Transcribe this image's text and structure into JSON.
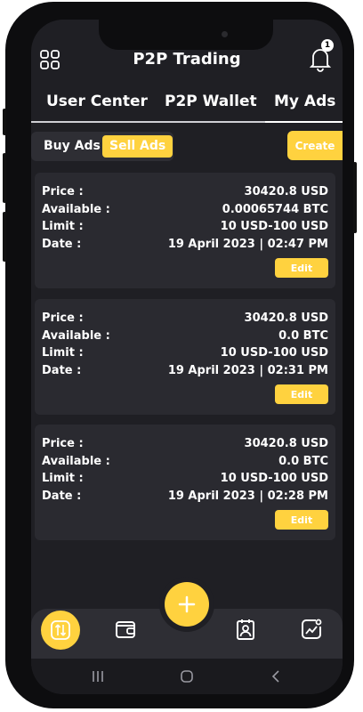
{
  "header": {
    "title": "P2P Trading",
    "notification_count": "1",
    "menu_icon": "grid-icon",
    "bell_icon": "bell-icon"
  },
  "tabs": [
    {
      "label": "User Center"
    },
    {
      "label": "P2P Wallet"
    },
    {
      "label": "My Ads",
      "active": true
    }
  ],
  "segment": {
    "buy_label": "Buy Ads",
    "sell_label": "Sell Ads",
    "selected": "Sell Ads"
  },
  "create_label": "Create",
  "labels": {
    "price": "Price :",
    "available": "Available :",
    "limit": "Limit :",
    "date": "Date :"
  },
  "ads": [
    {
      "price": "30420.8 USD",
      "available": "0.00065744 BTC",
      "limit": "10 USD-100 USD",
      "date": "19 April 2023 | 02:47 PM",
      "edit_label": "Edit"
    },
    {
      "price": "30420.8 USD",
      "available": "0.0 BTC",
      "limit": "10 USD-100 USD",
      "date": "19 April 2023 | 02:31 PM",
      "edit_label": "Edit"
    },
    {
      "price": "30420.8 USD",
      "available": "0.0 BTC",
      "limit": "10 USD-100 USD",
      "date": "19 April 2023 | 02:28 PM",
      "edit_label": "Edit"
    }
  ],
  "bottom_nav": [
    {
      "icon": "swap-icon",
      "active": true
    },
    {
      "icon": "wallet-icon"
    },
    {
      "icon": "add-icon"
    },
    {
      "icon": "contact-icon"
    },
    {
      "icon": "chart-icon"
    }
  ],
  "colors": {
    "accent": "#ffd23f",
    "background": "#1f1f24",
    "card": "#2a2a30"
  }
}
